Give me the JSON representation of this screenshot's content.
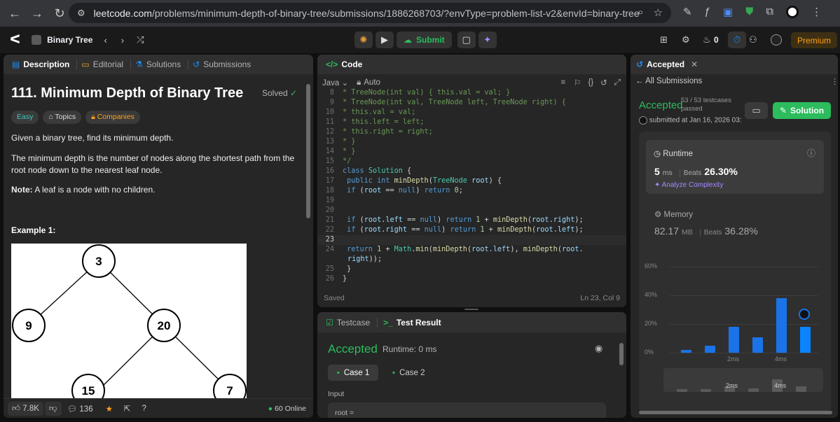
{
  "browser": {
    "url_host": "leetcode.com",
    "url_path": "/problems/minimum-depth-of-binary-tree/submissions/1886268703/?envType=problem-list-v2&envId=binary-tree"
  },
  "topbar": {
    "list_name": "Binary Tree",
    "submit_label": "Submit",
    "streak_count": "0",
    "premium_label": "Premium"
  },
  "left": {
    "tabs": [
      "Description",
      "Editorial",
      "Solutions",
      "Submissions"
    ],
    "title": "111. Minimum Depth of Binary Tree",
    "solved": "Solved",
    "tags": [
      "Easy",
      "Topics",
      "Companies"
    ],
    "p1": "Given a binary tree, find its minimum depth.",
    "p2": "The minimum depth is the number of nodes along the shortest path from the root node down to the nearest leaf node.",
    "note_label": "Note:",
    "note_text": "A leaf is a node with no children.",
    "example": "Example 1:",
    "tree_nodes": [
      "3",
      "9",
      "20",
      "15",
      "7"
    ],
    "likes": "7.8K",
    "comments": "136",
    "online": "60 Online"
  },
  "code": {
    "header": "Code",
    "language": "Java",
    "mode": "Auto",
    "status": "Saved",
    "cursor": "Ln 23, Col 9",
    "line_numbers": [
      "8",
      "9",
      "10",
      "11",
      "12",
      "13",
      "14",
      "15",
      "16",
      "17",
      "18",
      "19",
      "20",
      "21",
      "22",
      "23",
      "24",
      "",
      "25",
      "26"
    ]
  },
  "testresult": {
    "tab1": "Testcase",
    "tab2": "Test Result",
    "status": "Accepted",
    "runtime": "Runtime: 0 ms",
    "cases": [
      "Case 1",
      "Case 2"
    ],
    "input_label": "Input",
    "input_value": "root ="
  },
  "submission": {
    "tab": "Accepted",
    "back": "All Submissions",
    "status": "Accepted",
    "passed": "53 / 53 testcases passed",
    "submitted": "submitted at Jan 16, 2026 03:",
    "solution_label": "Solution",
    "runtime_label": "Runtime",
    "runtime_value": "5",
    "runtime_unit": "ms",
    "beats_label": "Beats",
    "runtime_beats": "26.30%",
    "analyze": "Analyze Complexity",
    "memory_label": "Memory",
    "memory_value": "82.17",
    "memory_unit": "MB",
    "memory_beats": "36.28%"
  },
  "chart_data": {
    "type": "bar",
    "yticks": [
      "60%",
      "40%",
      "20%",
      "0%"
    ],
    "ylim": [
      0,
      60
    ],
    "x_tick_labels": [
      "2ms",
      "4ms"
    ],
    "values": [
      2,
      5,
      18,
      10.5,
      38,
      18
    ],
    "highlight_index": 5,
    "colors": {
      "bar": "#1a73e8",
      "highlight": "#0a84ff"
    }
  }
}
